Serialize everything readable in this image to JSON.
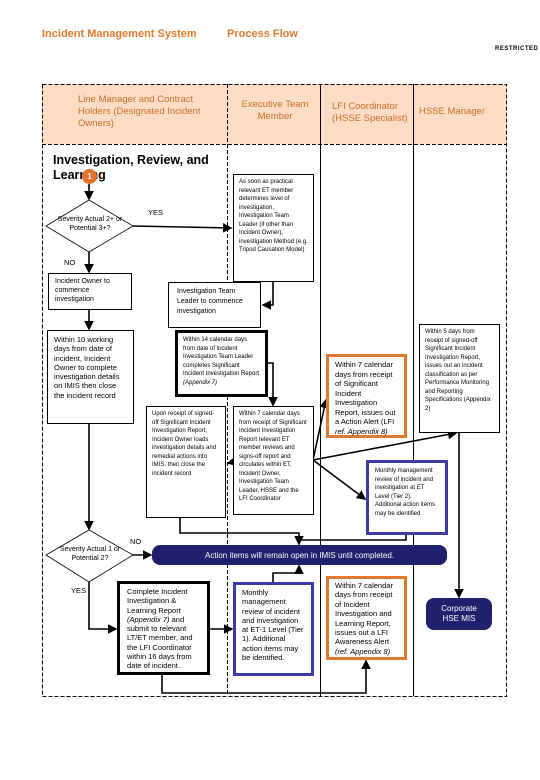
{
  "header": {
    "title": "Incident Management System",
    "subtitle": "Process Flow",
    "classification": "RESTRICTED"
  },
  "lanes": [
    "Line Manager and Contract Holders (Designated Incident Owners)",
    "Executive Team Member",
    "LFI Coordinator (HSSE Specialist)",
    "HSSE Manager"
  ],
  "section_title": "Investigation, Review, and Learning",
  "step_marker": "1",
  "colors": {
    "accent": "#e07b2e",
    "navy": "#20206c",
    "blue_border": "#3a3aa8",
    "lane_header": "#fcdcc4"
  },
  "decisions": {
    "d1": "Severity Actual 2+ or Potential 3+?",
    "d2": "Severity Actual 1 or Potential 2?"
  },
  "labels": {
    "yes1": "YES",
    "no1": "NO",
    "no2": "NO",
    "yes2": "YES"
  },
  "boxes": {
    "et_determine": "As soon as practical relevant ET member determines level of investigation, Investigation Team Leader (if other than Incident Owner), investigation Method (e.g. Tripod Causation Model)",
    "owner_commence": "Incident Owner to commence investigation",
    "itl_commence": "Investigation Team Leader to commence investigation",
    "within10": "Within 10 working days from date of incident, Incident Owner to complete investigation details on IMIS then close the incident record",
    "within14": "Within 14 calendar days from date of incident Investigation Team Leader completes Significant Incident Investigation Report",
    "within14_ref": "(Appendix 7)",
    "upon_receipt": "Upon receipt of signed-off Significant Incident Investigation Report, Incident Owner loads investigation details and remedial actions into IMIS, then close the incident record",
    "within7_et": "Within 7 calendar days from receipt of Significant Incident Investigation Report relevant ET member reviews and signs-off report and circulates within ET, Incident Owner, Investigation Team Leader, HSSE and the LFI Coordinator",
    "lfi_action_alert": "Within 7 calendar days from receipt of Significant Incident Investigation Report, issues out a Action Alert (LFI",
    "lfi_action_alert_ref": "ref. Appendix 8)",
    "hsse_5days": "Within 5 days from receipt of signed-off Significant Incident Investigation Report, issues out an incident classification as per Performance Monitoring and Reporting Specifications",
    "hsse_5days_ref": "(Appendix 2)",
    "monthly_et2": "Monthly management review of incident and investigation at ET Level (Tier 2). Additional action items may be identified",
    "complete_report": "Complete Incident Investigation & Learning Report",
    "complete_report_ref": "(Appendix 7)",
    "complete_report_rest": "and submit to relevant LT/ET member, and the LFI Coordinator within 16 days from date of incident.",
    "monthly_et1": "Monthly management review of incident and investigation at ET-1 Level (Tier 1). Additional action items may be identified.",
    "lfi_awareness": "Within 7 calendar days from receipt of Incident Investigation and Learning Report, issues out a LFI Awareness Alert",
    "lfi_awareness_ref": "(ref. Appendix 8)"
  },
  "action_items": "Action items will remain open in IMIS until completed.",
  "corporate": "Corporate HSE MIS"
}
